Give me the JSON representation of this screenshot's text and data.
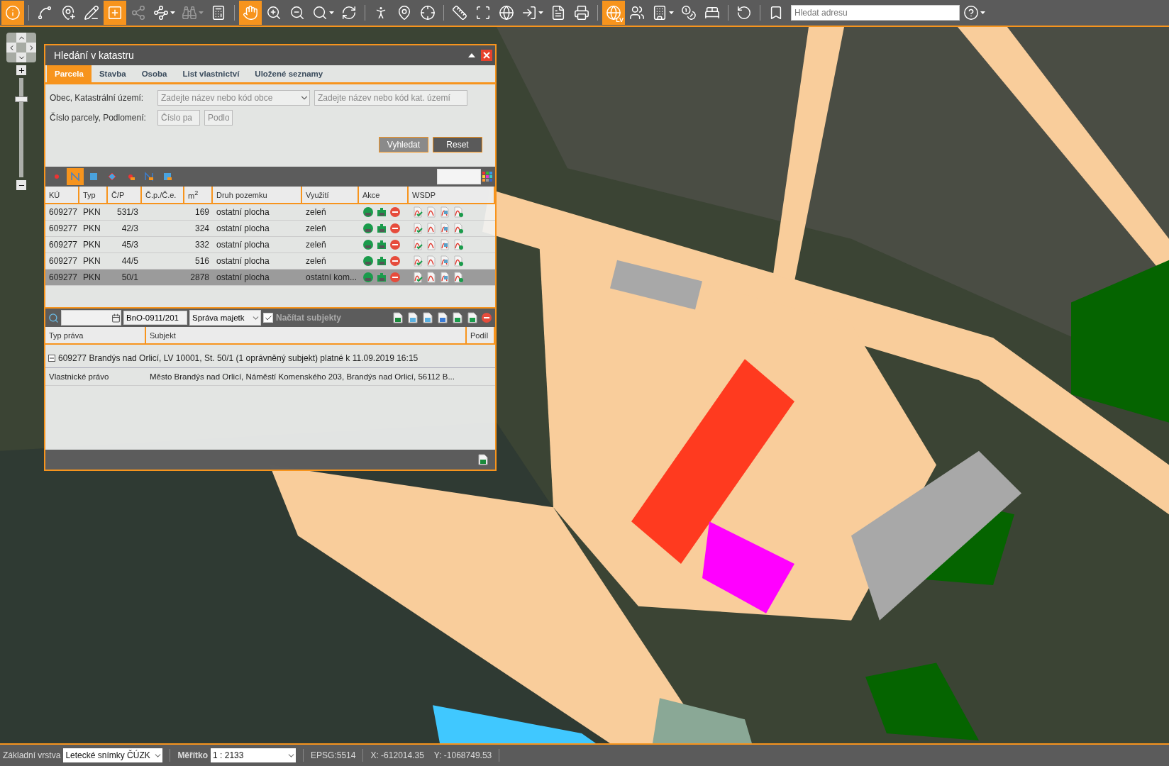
{
  "toolbar": {
    "groups": [
      [
        {
          "active": true,
          "disabled": false,
          "dropdown": false
        }
      ],
      [
        {
          "active": false,
          "disabled": false,
          "dropdown": false
        },
        {
          "active": false,
          "disabled": false,
          "dropdown": false
        },
        {
          "active": false,
          "disabled": false,
          "dropdown": false
        },
        {
          "active": true,
          "disabled": false,
          "dropdown": false
        },
        {
          "active": false,
          "disabled": true,
          "dropdown": false
        },
        {
          "active": false,
          "disabled": false,
          "dropdown": true
        },
        {
          "active": false,
          "disabled": true,
          "dropdown": true
        },
        {
          "active": false,
          "disabled": false,
          "dropdown": false
        }
      ],
      [
        {
          "active": true,
          "disabled": false,
          "dropdown": false
        },
        {
          "active": false,
          "disabled": false,
          "dropdown": false
        },
        {
          "active": false,
          "disabled": false,
          "dropdown": false
        },
        {
          "active": false,
          "disabled": false,
          "dropdown": true
        },
        {
          "active": false,
          "disabled": false,
          "dropdown": false
        }
      ],
      [
        {
          "active": false,
          "disabled": false,
          "dropdown": false
        },
        {
          "active": false,
          "disabled": false,
          "dropdown": false
        },
        {
          "active": false,
          "disabled": false,
          "dropdown": false
        }
      ],
      [
        {
          "active": false,
          "disabled": false,
          "dropdown": false
        },
        {
          "active": false,
          "disabled": false,
          "dropdown": false
        },
        {
          "active": false,
          "disabled": false,
          "dropdown": false
        },
        {
          "active": false,
          "disabled": false,
          "dropdown": true
        },
        {
          "active": false,
          "disabled": false,
          "dropdown": false
        },
        {
          "active": false,
          "disabled": false,
          "dropdown": false
        }
      ],
      [
        {
          "active": true,
          "disabled": false,
          "dropdown": false,
          "label": "LV"
        },
        {
          "active": false,
          "disabled": false,
          "dropdown": false
        },
        {
          "active": false,
          "disabled": false,
          "dropdown": true
        },
        {
          "active": false,
          "disabled": false,
          "dropdown": false
        },
        {
          "active": false,
          "disabled": false,
          "dropdown": false
        }
      ],
      [
        {
          "active": false,
          "disabled": false,
          "dropdown": false
        }
      ],
      [
        {
          "active": false,
          "disabled": false,
          "dropdown": false
        }
      ]
    ],
    "search": {
      "placeholder": "Hledat adresu"
    },
    "help": {
      "dropdown": true
    }
  },
  "map": {
    "kind": "picture",
    "zoom_slider": {
      "level": 0.8
    }
  },
  "dialog": {
    "title": "Hledání v katastru",
    "tabs": [
      {
        "label": "Parcela",
        "selected": true
      },
      {
        "label": "Stavba",
        "selected": false
      },
      {
        "label": "Osoba",
        "selected": false
      },
      {
        "label": "List vlastnictví",
        "selected": false
      },
      {
        "label": "Uložené seznamy",
        "selected": false
      }
    ],
    "form": {
      "municipality_label": "Obec, Katastrální území:",
      "municipality": {
        "placeholder": "Zadejte název nebo kód obce"
      },
      "cadastral_area": {
        "placeholder": "Zadejte název nebo kód kat. území"
      },
      "parcel_label": "Číslo parcely, Podlomení:",
      "parcel_number": {
        "placeholder": "Číslo pa"
      },
      "subdivision": {
        "placeholder": "Podlo"
      },
      "buttons": [
        {
          "label": "Vyhledat",
          "kind": "primary"
        },
        {
          "label": "Reset",
          "kind": "secondary"
        }
      ]
    },
    "selection_tools": [
      {
        "active": false
      },
      {
        "active": true
      },
      {
        "active": false
      },
      {
        "active": false
      },
      {
        "active": false
      },
      {
        "active": false
      },
      {
        "active": false
      }
    ],
    "table": {
      "columns": [
        "KÚ",
        "Typ",
        "Č/P",
        "Č.p./Č.e.",
        "m$^{2}$",
        "Druh pozemku",
        "Využití",
        "Akce",
        "WSDP"
      ],
      "rows": [
        {
          "ku": "609277",
          "type": "PKN",
          "parcel": "531/3",
          "area": "169",
          "land_type": "ostatní plocha",
          "use": "zeleň",
          "selected": false
        },
        {
          "ku": "609277",
          "type": "PKN",
          "parcel": "42/3",
          "area": "324",
          "land_type": "ostatní plocha",
          "use": "zeleň",
          "selected": false
        },
        {
          "ku": "609277",
          "type": "PKN",
          "parcel": "45/3",
          "area": "332",
          "land_type": "ostatní plocha",
          "use": "zeleň",
          "selected": false
        },
        {
          "ku": "609277",
          "type": "PKN",
          "parcel": "44/5",
          "area": "516",
          "land_type": "ostatní plocha",
          "use": "zeleň",
          "selected": false
        },
        {
          "ku": "609277",
          "type": "PKN",
          "parcel": "50/1",
          "area": "2878",
          "land_type": "ostatní plocha",
          "use": "ostatní kom...",
          "selected": true
        }
      ]
    },
    "owners_toolbar": {
      "document": "BnO-0911/201",
      "department": "Správa majetk",
      "load_subjects": {
        "label": "Načítat subjekty",
        "checked": true
      }
    },
    "owners": {
      "columns": [
        "Typ práva",
        "Subjekt",
        "Podíl"
      ],
      "group": {
        "label": "609277 Brandýs nad Orlicí, LV 10001, St. 50/1 (1 oprávněný subjekt) platné k 11.09.2019 16:15",
        "expanded": true
      },
      "rows": [
        {
          "right": "Vlastnické právo",
          "subject": "Město Brandýs nad Orlicí, Náměstí Komenského 203, Brandýs nad Orlicí, 56112 B..."
        }
      ]
    }
  },
  "status_bar": {
    "base_layer_label": "Základní vrstva",
    "base_layer": "Letecké snímky ČÚZK",
    "scale_label": "Měřítko",
    "scale": "1 : 2133",
    "epsg": "EPSG:5514",
    "x": "X: -612014.35",
    "y": "Y: -1068749.53"
  }
}
